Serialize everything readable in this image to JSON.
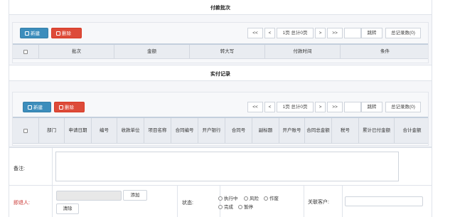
{
  "payment_batch": {
    "title": "付款批次",
    "new_label": "新建",
    "delete_label": "删除",
    "pager": {
      "first": "<<",
      "prev": "<",
      "page_info": "1页 总计0页",
      "next": ">",
      "last": ">>",
      "jump": "跳转",
      "total": "总记录数(0)"
    },
    "columns": [
      "批次",
      "金额",
      "转大写",
      "付款时间",
      "条件"
    ]
  },
  "actual_payments": {
    "title": "实付记录",
    "new_label": "新建",
    "delete_label": "删除",
    "pager": {
      "first": "<<",
      "prev": "<",
      "page_info": "1页 总计0页",
      "next": ">",
      "last": ">>",
      "jump": "跳转",
      "total": "总记录数(0)"
    },
    "columns": [
      "部门",
      "申请日期",
      "编号",
      "收款单位",
      "项目名称",
      "合同编号",
      "开户银行",
      "合同号",
      "副标题",
      "开户账号",
      "合同总金额",
      "税号",
      "累计已付金额",
      "合计金额"
    ]
  },
  "form": {
    "remark_label": "备注:",
    "handler_label": "即退人:",
    "add_label": "添加",
    "clear_label": "清除",
    "status_label": "状态:",
    "status_options": [
      "执行中",
      "风险",
      "作废",
      "完成",
      "暂停"
    ],
    "related_client_label": "关联客户:"
  },
  "colors": {
    "primary": "#3c8dbc",
    "danger": "#dd4b39",
    "required": "#c9302c"
  }
}
